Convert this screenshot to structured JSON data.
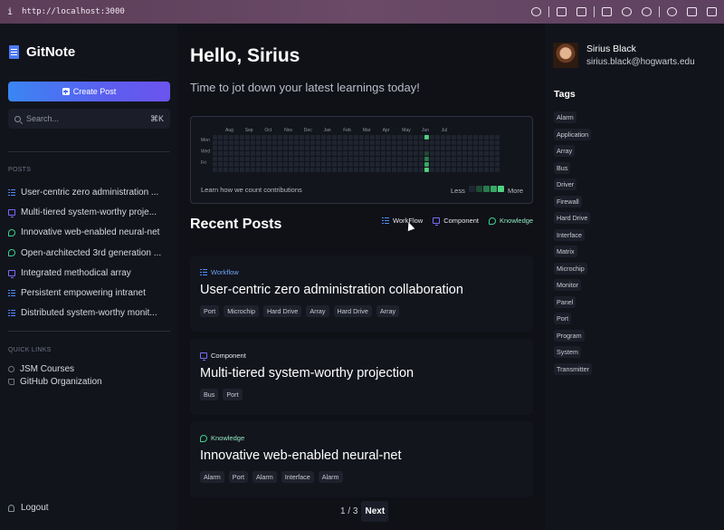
{
  "browser": {
    "info": "i",
    "url": "http://localhost:3000"
  },
  "sidebar": {
    "logo": "GitNote",
    "create_label": "Create Post",
    "search": {
      "placeholder": "Search...",
      "shortcut": "⌘K"
    },
    "posts_label": "POSTS",
    "posts": [
      {
        "label": "User-centric zero administration ...",
        "type": "workflow"
      },
      {
        "label": "Multi-tiered system-worthy proje...",
        "type": "component"
      },
      {
        "label": "Innovative web-enabled neural-net",
        "type": "knowledge"
      },
      {
        "label": "Open-architected 3rd generation ...",
        "type": "knowledge"
      },
      {
        "label": "Integrated methodical array",
        "type": "component"
      },
      {
        "label": "Persistent empowering intranet",
        "type": "workflow"
      },
      {
        "label": "Distributed system-worthy monit...",
        "type": "workflow"
      }
    ],
    "quick_links_label": "QUICK LINKS",
    "quick_links": [
      {
        "label": "JSM Courses"
      },
      {
        "label": "GitHub Organization"
      }
    ],
    "logout_label": "Logout"
  },
  "main": {
    "greeting": "Hello, Sirius",
    "subtitle": "Time to jot down your latest learnings today!",
    "contributions": {
      "months": [
        "Aug",
        "Sep",
        "Oct",
        "Nov",
        "Dec",
        "Jan",
        "Feb",
        "Mar",
        "Apr",
        "May",
        "Jun",
        "Jul"
      ],
      "days": [
        "Mon",
        "Wed",
        "Fri"
      ],
      "learn_link": "Learn how we count contributions",
      "less": "Less",
      "more": "More",
      "colors": [
        "#1f2530",
        "#1f4a34",
        "#2a7a4e",
        "#39a866",
        "#4fd37f"
      ]
    },
    "recent_title": "Recent Posts",
    "filters": {
      "workflow": "WorkFlow",
      "component": "Component",
      "knowledge": "Knowledge"
    },
    "cards": [
      {
        "category": "Workflow",
        "title": "User-centric zero administration collaboration",
        "tags": [
          "Port",
          "Microchip",
          "Hard Drive",
          "Array",
          "Hard Drive",
          "Array"
        ]
      },
      {
        "category": "Component",
        "title": "Multi-tiered system-worthy projection",
        "tags": [
          "Bus",
          "Port"
        ]
      },
      {
        "category": "Knowledge",
        "title": "Innovative web-enabled neural-net",
        "tags": [
          "Alarm",
          "Port",
          "Alarm",
          "Interface",
          "Alarm"
        ]
      }
    ],
    "pager": {
      "page": "1 / 3",
      "next": "Next"
    }
  },
  "user": {
    "name": "Sirius Black",
    "email": "sirius.black@hogwarts.edu"
  },
  "tags": {
    "title": "Tags",
    "items": [
      "Alarm",
      "Application",
      "Array",
      "Bus",
      "Driver",
      "Firewall",
      "Hard Drive",
      "Interface",
      "Matrix",
      "Microchip",
      "Monitor",
      "Panel",
      "Port",
      "Program",
      "System",
      "Transmitter"
    ]
  },
  "colors": {
    "workflow": "#4e8df5",
    "component": "#7a6cf3",
    "knowledge": "#3ecf8e",
    "accent": "#5b5ff0"
  }
}
